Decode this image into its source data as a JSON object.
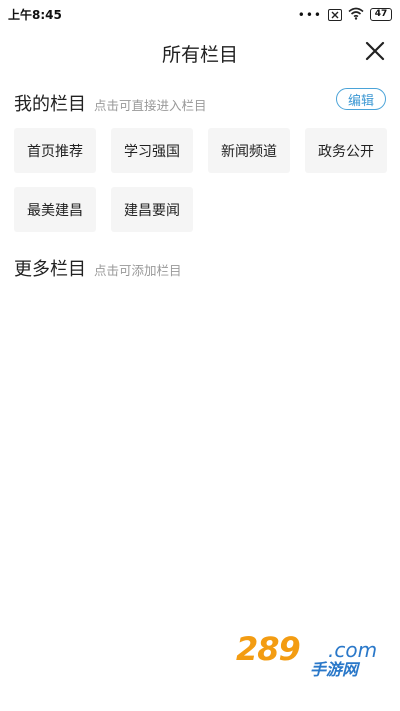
{
  "status_bar": {
    "time": "上午8:45",
    "dots": "•••",
    "battery": "47",
    "icons": [
      "signal-x-icon",
      "wifi-icon",
      "battery-icon"
    ]
  },
  "header": {
    "title": "所有栏目",
    "close_icon": "close-icon"
  },
  "my_section": {
    "title": "我的栏目",
    "hint": "点击可直接进入栏目",
    "edit_label": "编辑",
    "channels": [
      "首页推荐",
      "学习强国",
      "新闻频道",
      "政务公开",
      "最美建昌",
      "建昌要闻"
    ]
  },
  "more_section": {
    "title": "更多栏目",
    "hint": "点击可添加栏目"
  },
  "watermark": {
    "number": "289",
    "domain": ".com",
    "name": "手游网"
  },
  "colors": {
    "accent": "#3d98d3",
    "chip_bg": "#f5f5f5",
    "hint": "#999999"
  }
}
